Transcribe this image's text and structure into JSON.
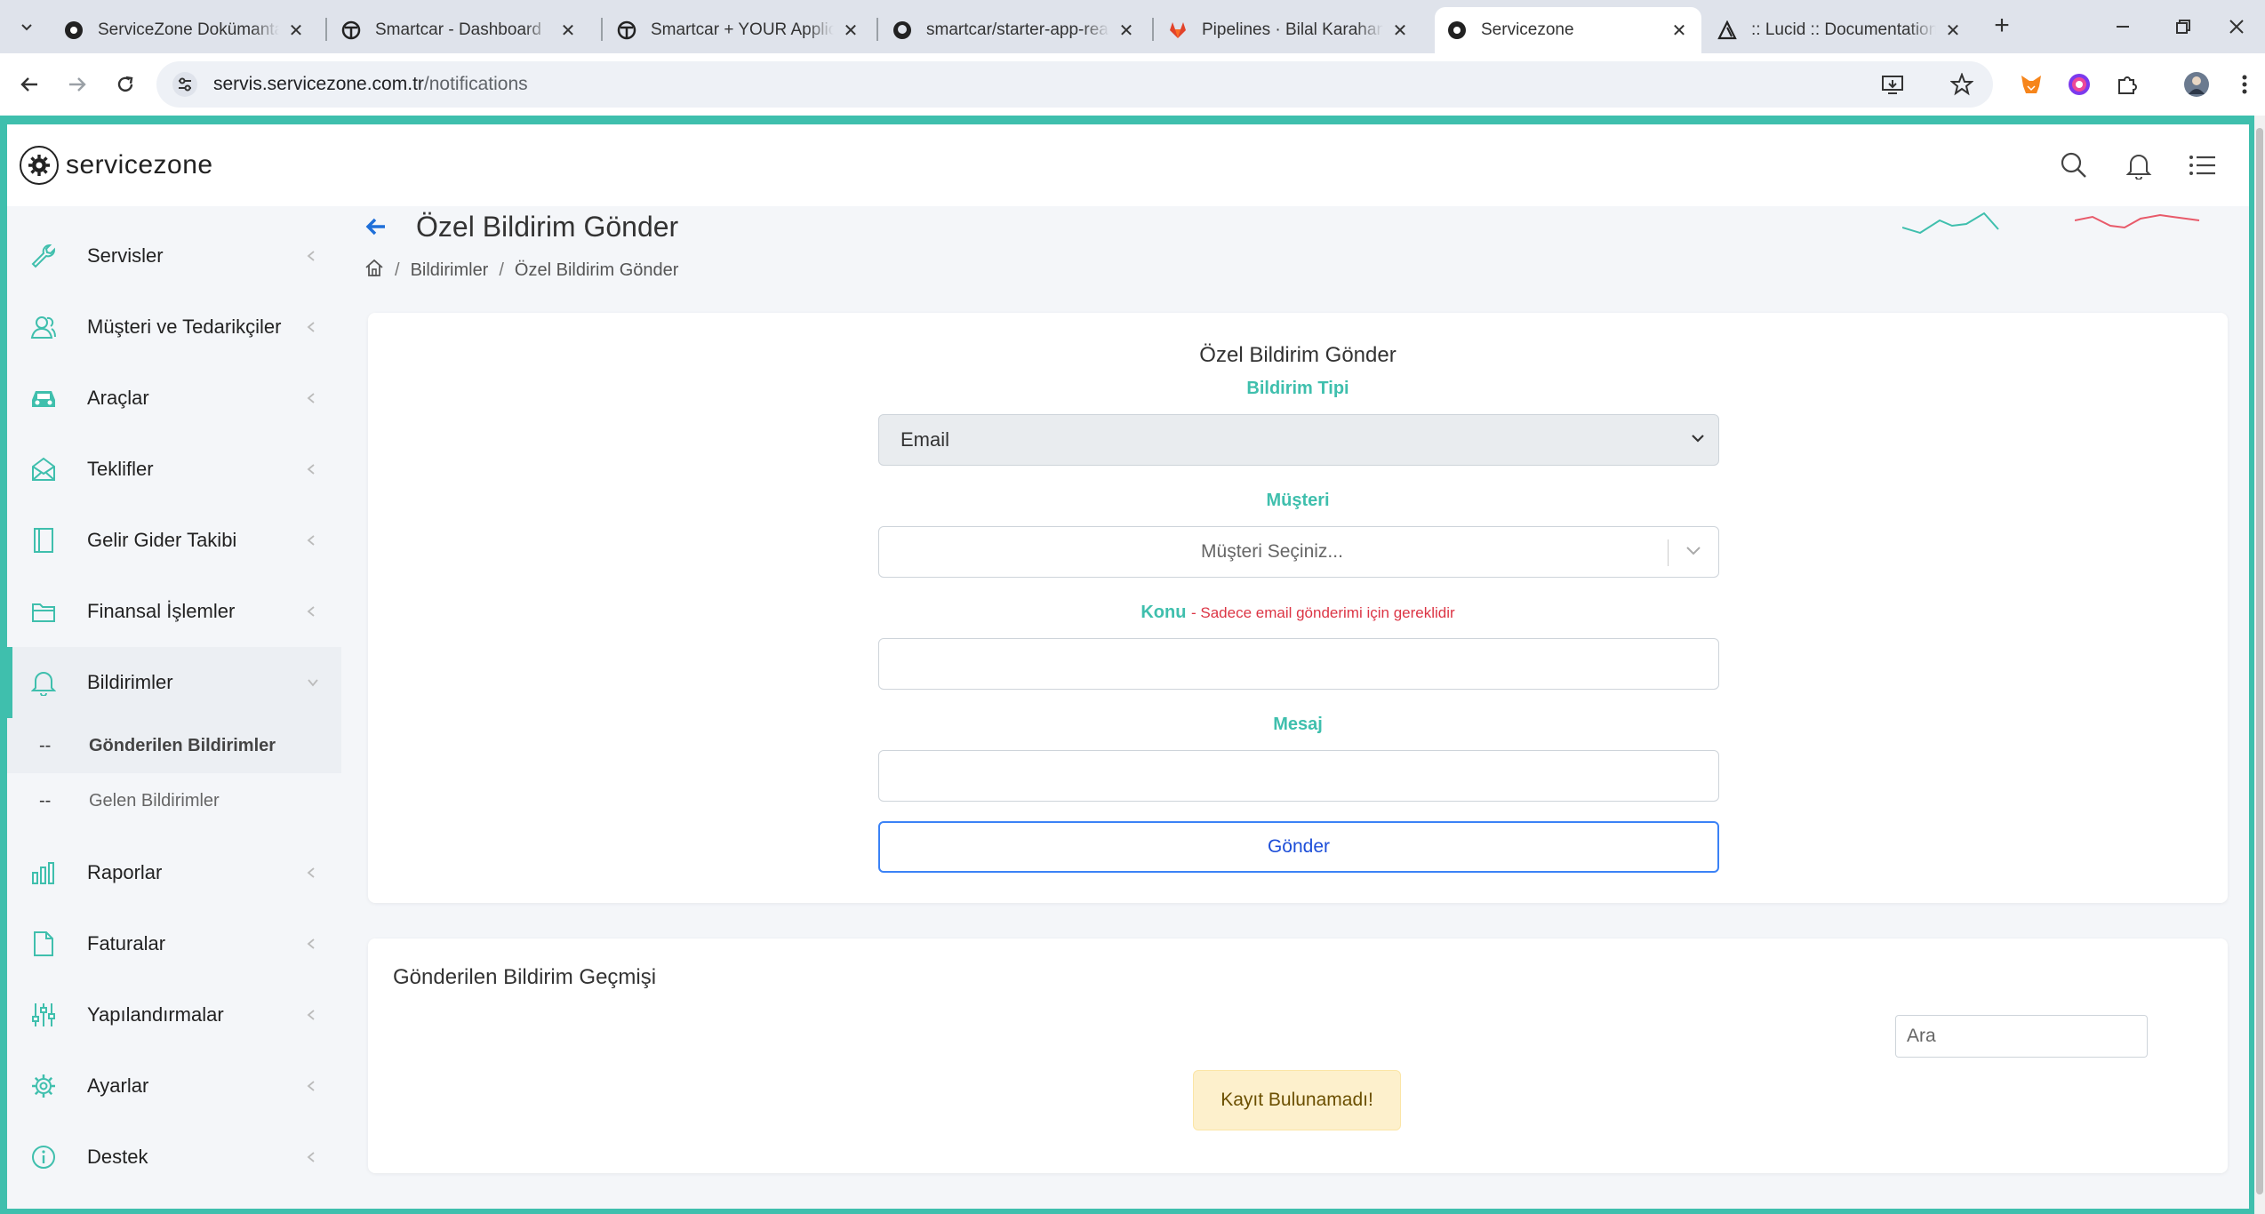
{
  "browser": {
    "tabs": [
      {
        "title": "ServiceZone Dokümantasyon",
        "favicon": "servicezone-icon"
      },
      {
        "title": "Smartcar - Dashboard",
        "favicon": "smartcar-icon"
      },
      {
        "title": "Smartcar + YOUR Application",
        "favicon": "smartcar-icon"
      },
      {
        "title": "smartcar/starter-app-react",
        "favicon": "github-icon"
      },
      {
        "title": "Pipelines · Bilal Karahan / ...",
        "favicon": "gitlab-icon"
      },
      {
        "title": "Servicezone",
        "favicon": "servicezone-icon",
        "active": true
      },
      {
        "title": ":: Lucid :: Documentation",
        "favicon": "lucid-icon"
      }
    ],
    "url_host": "servis.servicezone.com.tr",
    "url_path": "/notifications"
  },
  "app": {
    "logo_text": "servicezone",
    "accent_color": "#3fbfad"
  },
  "sidebar": {
    "items": [
      {
        "label": "Servisler",
        "icon": "wrench-icon"
      },
      {
        "label": "Müşteri ve Tedarikçiler",
        "icon": "users-icon"
      },
      {
        "label": "Araçlar",
        "icon": "car-icon"
      },
      {
        "label": "Teklifler",
        "icon": "envelope-open-icon"
      },
      {
        "label": "Gelir Gider Takibi",
        "icon": "ledger-icon"
      },
      {
        "label": "Finansal İşlemler",
        "icon": "wallet-icon"
      },
      {
        "label": "Bildirimler",
        "icon": "bell-icon",
        "expanded": true
      },
      {
        "label": "Raporlar",
        "icon": "bar-chart-icon"
      },
      {
        "label": "Faturalar",
        "icon": "file-icon"
      },
      {
        "label": "Yapılandırmalar",
        "icon": "sliders-icon"
      },
      {
        "label": "Ayarlar",
        "icon": "gear-icon"
      },
      {
        "label": "Destek",
        "icon": "info-icon"
      }
    ],
    "sub_items": [
      {
        "dash": "--",
        "label": "Gönderilen Bildirimler",
        "active": true
      },
      {
        "dash": "--",
        "label": "Gelen Bildirimler"
      }
    ]
  },
  "page": {
    "title": "Özel Bildirim Gönder",
    "breadcrumb": [
      "Bildirimler",
      "Özel Bildirim Gönder"
    ]
  },
  "form": {
    "title": "Özel Bildirim Gönder",
    "type_label": "Bildirim Tipi",
    "type_value": "Email",
    "customer_label": "Müşteri",
    "customer_placeholder": "Müşteri Seçiniz...",
    "subject_label": "Konu",
    "subject_note": "- Sadece email gönderimi için gereklidir",
    "subject_value": "",
    "message_label": "Mesaj",
    "message_value": "",
    "submit_label": "Gönder"
  },
  "history": {
    "title": "Gönderilen Bildirim Geçmişi",
    "search_placeholder": "Ara",
    "empty_text": "Kayıt Bulunamadı!"
  }
}
